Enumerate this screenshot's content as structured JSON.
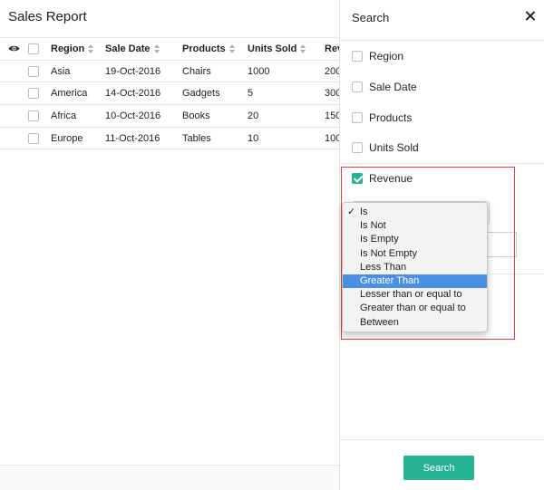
{
  "report": {
    "title": "Sales Report",
    "columns": [
      "Region",
      "Sale Date",
      "Products",
      "Units Sold",
      "Rev"
    ],
    "rows": [
      {
        "region": "Asia",
        "date": "19-Oct-2016",
        "product": "Chairs",
        "units": "1000",
        "revenue": "200"
      },
      {
        "region": "America",
        "date": "14-Oct-2016",
        "product": "Gadgets",
        "units": "5",
        "revenue": "300"
      },
      {
        "region": "Africa",
        "date": "10-Oct-2016",
        "product": "Books",
        "units": "20",
        "revenue": "150"
      },
      {
        "region": "Europe",
        "date": "11-Oct-2016",
        "product": "Tables",
        "units": "10",
        "revenue": "100"
      }
    ]
  },
  "search_panel": {
    "title": "Search",
    "fields": [
      {
        "label": "Region",
        "checked": false
      },
      {
        "label": "Sale Date",
        "checked": false
      },
      {
        "label": "Products",
        "checked": false
      },
      {
        "label": "Units Sold",
        "checked": false
      },
      {
        "label": "Revenue",
        "checked": true
      }
    ],
    "operator_options": [
      {
        "label": "Is",
        "checked": true
      },
      {
        "label": "Is Not"
      },
      {
        "label": "Is Empty"
      },
      {
        "label": "Is Not Empty"
      },
      {
        "label": "Less Than"
      },
      {
        "label": "Greater Than",
        "highlighted": true
      },
      {
        "label": "Lesser than or equal to"
      },
      {
        "label": "Greater than or equal to"
      },
      {
        "label": "Between"
      }
    ],
    "search_button": "Search"
  },
  "colors": {
    "accent": "#26b394",
    "highlight_border": "#e23b3b",
    "selected_option": "#4a90e2"
  }
}
